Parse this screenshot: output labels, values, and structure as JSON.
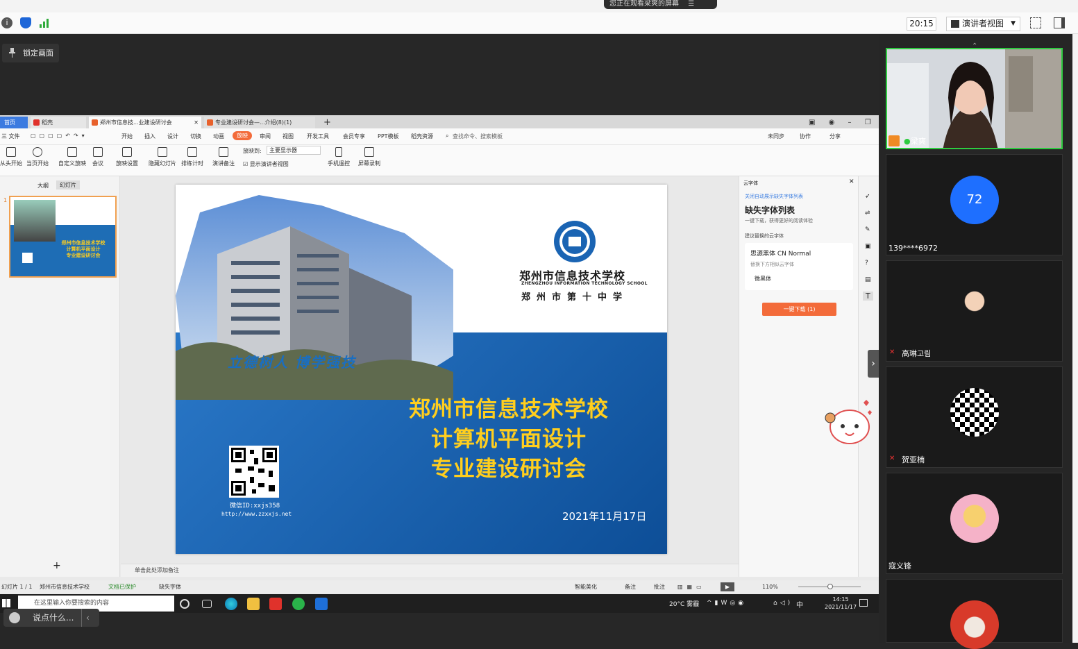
{
  "meeting": {
    "share_banner": "您正在观看梁爽的屏幕",
    "clock": "20:15",
    "view_mode": "演讲者视图",
    "lock_label": "锁定画面",
    "say_placeholder": "说点什么...",
    "participant_count": "72"
  },
  "participants": [
    {
      "name": "梁爽"
    },
    {
      "name": "139****6972"
    },
    {
      "name": "高琳고림"
    },
    {
      "name": "贺亚楠"
    },
    {
      "name": "寇义锋"
    }
  ],
  "wps": {
    "tabs": [
      "首页",
      "稻壳",
      "郑州市信息技...业建设研讨会",
      "专业建设研讨会—...介绍(8)(1)"
    ],
    "menu": [
      "三 文件",
      "开始",
      "插入",
      "设计",
      "切换",
      "动画",
      "放映",
      "审阅",
      "视图",
      "开发工具",
      "会员专享",
      "PPT模板",
      "稻壳资源",
      "查找命令、搜索模板",
      "未同步",
      "协作",
      "分享"
    ],
    "ribbon": {
      "from_start": "从头开始",
      "from_current": "当页开始",
      "custom_show": "自定义放映",
      "meeting": "会议",
      "show_settings": "放映设置",
      "hide_slide": "隐藏幻灯片",
      "rehearse": "排练计时",
      "presenter_notes": "演讲备注",
      "show_to_label": "放映到:",
      "show_to_value": "主要显示器",
      "show_presenter_view": "显示演讲者视图",
      "phone_remote": "手机遥控",
      "screen_record": "屏幕录制"
    },
    "left_tabs": [
      "大纲",
      "幻灯片"
    ],
    "slide_number": "1",
    "notes_placeholder": "单击此处添加备注",
    "status": {
      "slide_count": "幻灯片 1 / 1",
      "theme": "郑州市信息技术学校",
      "protected": "文档已保护",
      "missing_font": "缺失字体",
      "beautify": "智能美化",
      "notes": "备注",
      "comments": "批注",
      "zoom": "110%"
    },
    "font_panel": {
      "header": "云字体",
      "link": "关闭自动展示缺失字体列表",
      "title": "缺失字体列表",
      "subtitle": "一键下载，获得更好的阅读体验",
      "suggest": "建议替换的云字体",
      "font_name": "思源黑体 CN Normal",
      "replace_hint": "替换下方相似云字体",
      "similar": "微黑体",
      "download": "一键下载 (1)"
    }
  },
  "slide": {
    "school_cn": "郑州市信息技术学校",
    "school_en": "ZHENGZHOU INFORMATION TECHNOLOGY SCHOOL",
    "school_sub": "郑州市第十中学",
    "motto": "立德树人  博学强技",
    "title_lines": [
      "郑州市信息技术学校",
      "计算机平面设计",
      "专业建设研讨会"
    ],
    "wechat": "微信ID:xxjs358",
    "url": "http://www.zzxxjs.net",
    "date": "2021年11月17日"
  },
  "taskbar": {
    "search_placeholder": "在这里输入你要搜索的内容",
    "weather": "20°C 雾霾",
    "ime": "中",
    "time": "14:15",
    "date": "2021/11/17"
  },
  "colors": {
    "accent_orange": "#f36b3a",
    "slide_blue": "#1a64b3",
    "title_yellow": "#ffce1e",
    "active_border": "#2ecc40"
  }
}
